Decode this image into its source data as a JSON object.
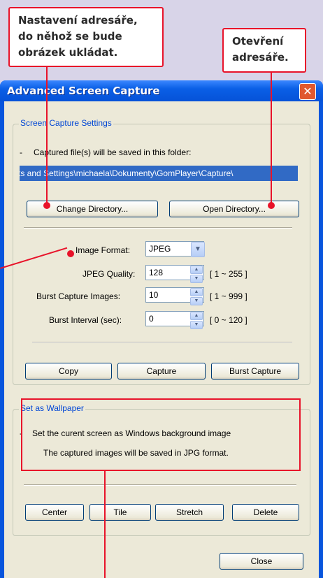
{
  "callouts": {
    "directory_setting": [
      "Nastavení adresáře,",
      "do něhož se bude",
      "obrázek ukládat."
    ],
    "open_directory": [
      "Otevření",
      "adresáře."
    ]
  },
  "window": {
    "title": "Advanced Screen Capture",
    "close_glyph": "✕"
  },
  "capture_settings": {
    "legend": "Screen Capture Settings",
    "info_dash": "-",
    "info_text": "Captured file(s) will be saved in this folder:",
    "path_value": "ts and Settings\\michaela\\Dokumenty\\GomPlayer\\Capture\\",
    "change_directory_label": "Change Directory...",
    "open_directory_label": "Open Directory...",
    "image_format_label": "Image Format:",
    "image_format_value": "JPEG",
    "jpeg_quality_label": "JPEG Quality:",
    "jpeg_quality_value": "128",
    "jpeg_quality_range": "[ 1 ~ 255 ]",
    "burst_images_label": "Burst Capture Images:",
    "burst_images_value": "10",
    "burst_images_range": "[ 1 ~ 999 ]",
    "burst_interval_label": "Burst Interval (sec):",
    "burst_interval_value": "0",
    "burst_interval_range": "[ 0 ~ 120 ]",
    "copy_label": "Copy",
    "capture_label": "Capture",
    "burst_capture_label": "Burst Capture"
  },
  "wallpaper": {
    "legend": "Set as Wallpaper",
    "dash": "-",
    "line1": "Set the curent screen as Windows background image",
    "line2": "The captured images will be saved in JPG format.",
    "center_label": "Center",
    "tile_label": "Tile",
    "stretch_label": "Stretch",
    "delete_label": "Delete"
  },
  "footer": {
    "close_label": "Close"
  },
  "colors": {
    "accent_red": "#e8132a",
    "xp_blue": "#0855dd",
    "selection_blue": "#316ac5"
  }
}
